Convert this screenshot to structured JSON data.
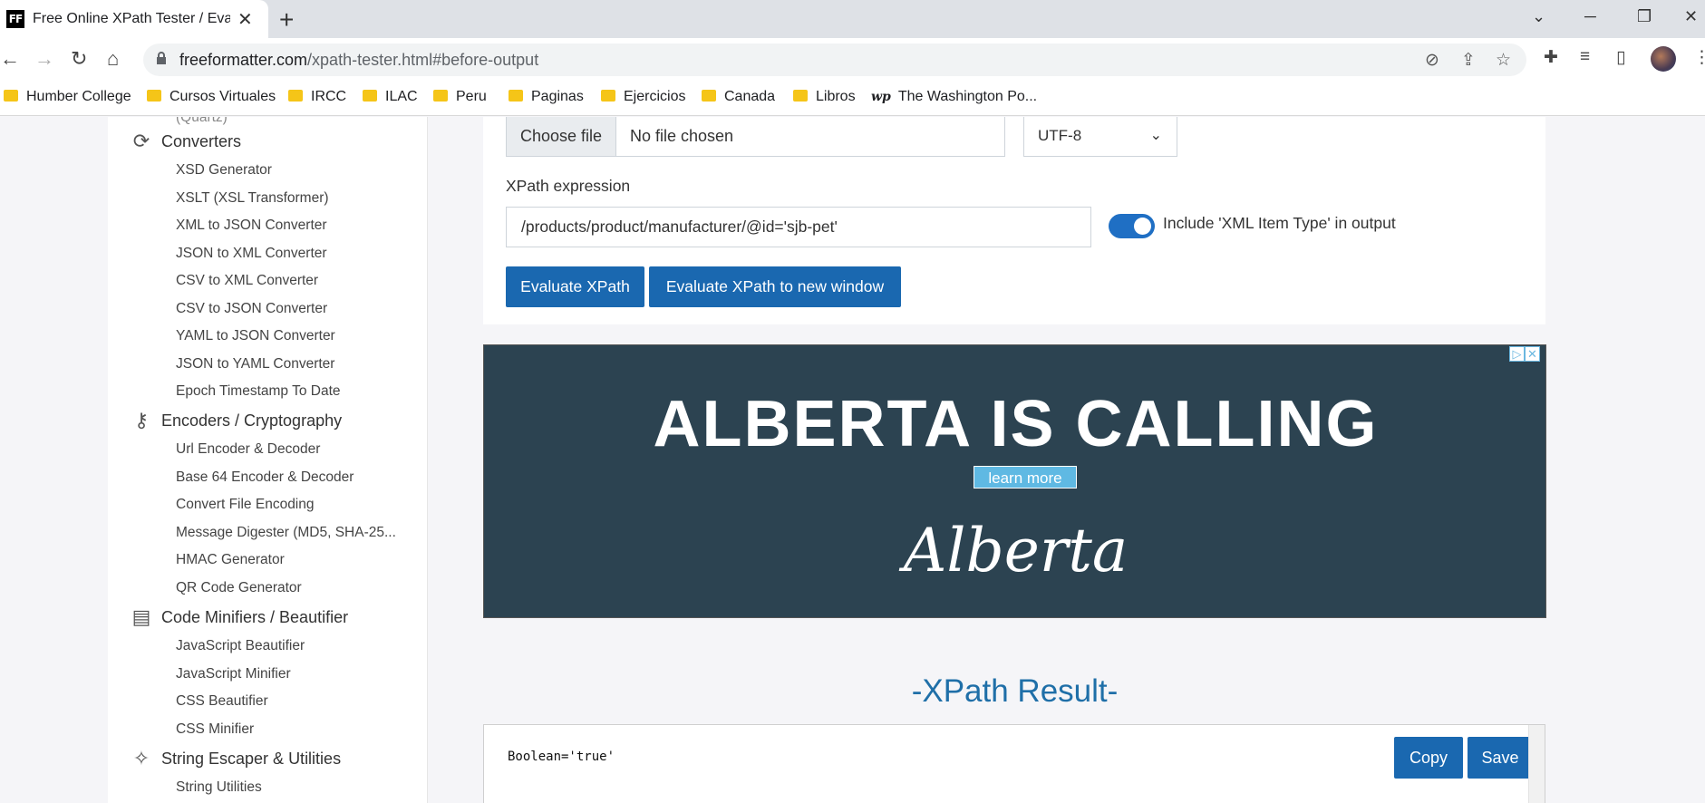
{
  "browser": {
    "tab_title": "Free Online XPath Tester / Evaluator",
    "favicon_text": "FF",
    "url_domain": "freeformatter.com",
    "url_path": "/xpath-tester.html#before-output",
    "bookmarks": [
      "Humber College",
      "Cursos Virtuales",
      "IRCC",
      "ILAC",
      "Peru",
      "Paginas",
      "Ejercicios",
      "Canada",
      "Libros",
      "The Washington Po..."
    ],
    "bookmark_wp_glyph": "wp"
  },
  "sidebar": {
    "partial_top": "(Quartz)",
    "categories": [
      {
        "label": "Converters",
        "icon": "refresh-icon",
        "items": [
          "XSD Generator",
          "XSLT (XSL Transformer)",
          "XML to JSON Converter",
          "JSON to XML Converter",
          "CSV to XML Converter",
          "CSV to JSON Converter",
          "YAML to JSON Converter",
          "JSON to YAML Converter",
          "Epoch Timestamp To Date"
        ]
      },
      {
        "label": "Encoders / Cryptography",
        "icon": "key-icon",
        "items": [
          "Url Encoder & Decoder",
          "Base 64 Encoder & Decoder",
          "Convert File Encoding",
          "Message Digester (MD5, SHA-25...",
          "HMAC Generator",
          "QR Code Generator"
        ]
      },
      {
        "label": "Code Minifiers / Beautifier",
        "icon": "zip-file-icon",
        "items": [
          "JavaScript Beautifier",
          "JavaScript Minifier",
          "CSS Beautifier",
          "CSS Minifier"
        ]
      },
      {
        "label": "String Escaper & Utilities",
        "icon": "magic-wand-icon",
        "items": [
          "String Utilities"
        ]
      }
    ]
  },
  "form": {
    "choose_file_label": "Choose file",
    "file_name": "No file chosen",
    "encoding": "UTF-8",
    "xpath_label": "XPath expression",
    "xpath_value": "/products/product/manufacturer/@id='sjb-pet'",
    "toggle_label": "Include 'XML Item Type' in output",
    "toggle_on": true,
    "evaluate_label": "Evaluate XPath",
    "evaluate_new_window_label": "Evaluate XPath to new window"
  },
  "ad": {
    "headline": "ALBERTA IS CALLING",
    "cta": "learn more",
    "logo_text": "Alberta",
    "adchoices_i": "▷",
    "adchoices_x": "✕"
  },
  "result": {
    "title": "-XPath Result-",
    "text": "Boolean='true'",
    "copy_label": "Copy",
    "save_label": "Save"
  },
  "colors": {
    "accent": "#1a68b0",
    "result_title": "#1f6fa8",
    "ad_background": "#2c4351"
  }
}
